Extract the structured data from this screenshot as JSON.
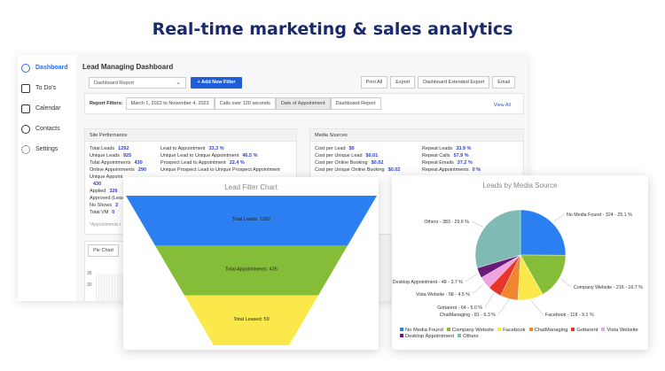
{
  "hero_title": "Real-time marketing & sales analytics",
  "sidebar": {
    "items": [
      {
        "label": "Dashboard",
        "icon": "pie-icon"
      },
      {
        "label": "To Do's",
        "icon": "clipboard-icon"
      },
      {
        "label": "Calendar",
        "icon": "calendar-icon"
      },
      {
        "label": "Contacts",
        "icon": "contacts-icon"
      },
      {
        "label": "Settings",
        "icon": "gear-icon"
      }
    ]
  },
  "header": {
    "title": "Lead Managing Dashboard",
    "report_select": "Dashboard Report",
    "add_filter": "+ Add New Filter",
    "actions": [
      "Print All",
      "Export",
      "Dashboard Extended Export",
      "Email"
    ]
  },
  "filters": {
    "label": "Report Filters:",
    "chips": [
      "March 1, 2022 to November 4, 2022",
      "Calls over 120 seconds",
      "Date of Appointment",
      "Dashboard Report"
    ],
    "view_all": "View All"
  },
  "site_performance": {
    "title": "Site Performance",
    "left": [
      [
        "Total Leads",
        "1292"
      ],
      [
        "Unique Leads",
        "925"
      ],
      [
        "Total Appointments",
        "430"
      ],
      [
        "Online Appointments",
        "290"
      ],
      [
        "Unique Appoint",
        ""
      ],
      [
        "",
        "430"
      ],
      [
        "Applied",
        "326"
      ],
      [
        "Approved (Leas",
        ""
      ],
      [
        "No Shows",
        "2"
      ],
      [
        "Total VM",
        "0"
      ]
    ],
    "right": [
      [
        "Lead to Appointment",
        "33.3 %"
      ],
      [
        "Unique Lead to Unique Appointment",
        "46.5 %"
      ],
      [
        "Prospect Lead to Appointment",
        "22.4 %"
      ],
      [
        "Unique Prospect Lead to Unique Prospect Appointment",
        ""
      ]
    ],
    "note": "*Appointments t"
  },
  "media_sources": {
    "title": "Media Sources",
    "left": [
      [
        "Cost per Lead",
        "$0"
      ],
      [
        "Cost per Unique Lead",
        "$0.01"
      ],
      [
        "Cost per Online Booking",
        "$0.02"
      ],
      [
        "Cost per Unique Online Booking",
        "$0.02"
      ]
    ],
    "right": [
      [
        "Repeat Leads",
        "33.9 %"
      ],
      [
        "Repeat Calls",
        "57.9 %"
      ],
      [
        "Repeat Emails",
        "37.2 %"
      ],
      [
        "Repeat Appointments",
        "0 %"
      ]
    ]
  },
  "pie_chart_button": "Pie Chart",
  "bg_axis_ticks": [
    "35",
    "30"
  ],
  "chart_data": [
    {
      "type": "funnel",
      "title": "Lead Filter Chart",
      "categories": [
        "Total Leads",
        "Total Appointments",
        "Total Leased"
      ],
      "values": [
        1292,
        426,
        59
      ],
      "labels": [
        "Total Leads: 1292",
        "Total Appointments: 426",
        "Total Leased: 59"
      ],
      "colors": [
        "#2b7ff0",
        "#86bd38",
        "#fbe94c"
      ]
    },
    {
      "type": "pie",
      "title": "Leads by Media Source",
      "legend": "bottom",
      "slices": [
        {
          "name": "No Media Found",
          "value": 324,
          "percent": 25.1,
          "label": "No Media Found - 324 - 25.1 %",
          "color": "#2b7ff0"
        },
        {
          "name": "Company Website",
          "value": 216,
          "percent": 16.7,
          "label": "Company Website - 216 - 16.7 %",
          "color": "#86bd38"
        },
        {
          "name": "Facebook",
          "value": 118,
          "percent": 9.1,
          "label": "Facebook - 118 - 9.1 %",
          "color": "#fbe94c"
        },
        {
          "name": "ChatManaging",
          "value": 81,
          "percent": 6.3,
          "label": "ChatManaging - 81 - 6.3 %",
          "color": "#f0852f"
        },
        {
          "name": "Gottarent",
          "value": 64,
          "percent": 5.0,
          "label": "Gottarent - 64 - 5.0 %",
          "color": "#e8352a"
        },
        {
          "name": "Vista Website",
          "value": 58,
          "percent": 4.5,
          "label": "Vista Website - 58 - 4.5 %",
          "color": "#f0a3e0"
        },
        {
          "name": "Desktop Appointment",
          "value": 48,
          "percent": 3.7,
          "label": "Desktop Appointment - 48 - 3.7 %",
          "color": "#6b1a7a"
        },
        {
          "name": "Others",
          "value": 383,
          "percent": 29.6,
          "label": "Others - 383 - 29.6 %",
          "color": "#7fbab5"
        }
      ]
    }
  ]
}
